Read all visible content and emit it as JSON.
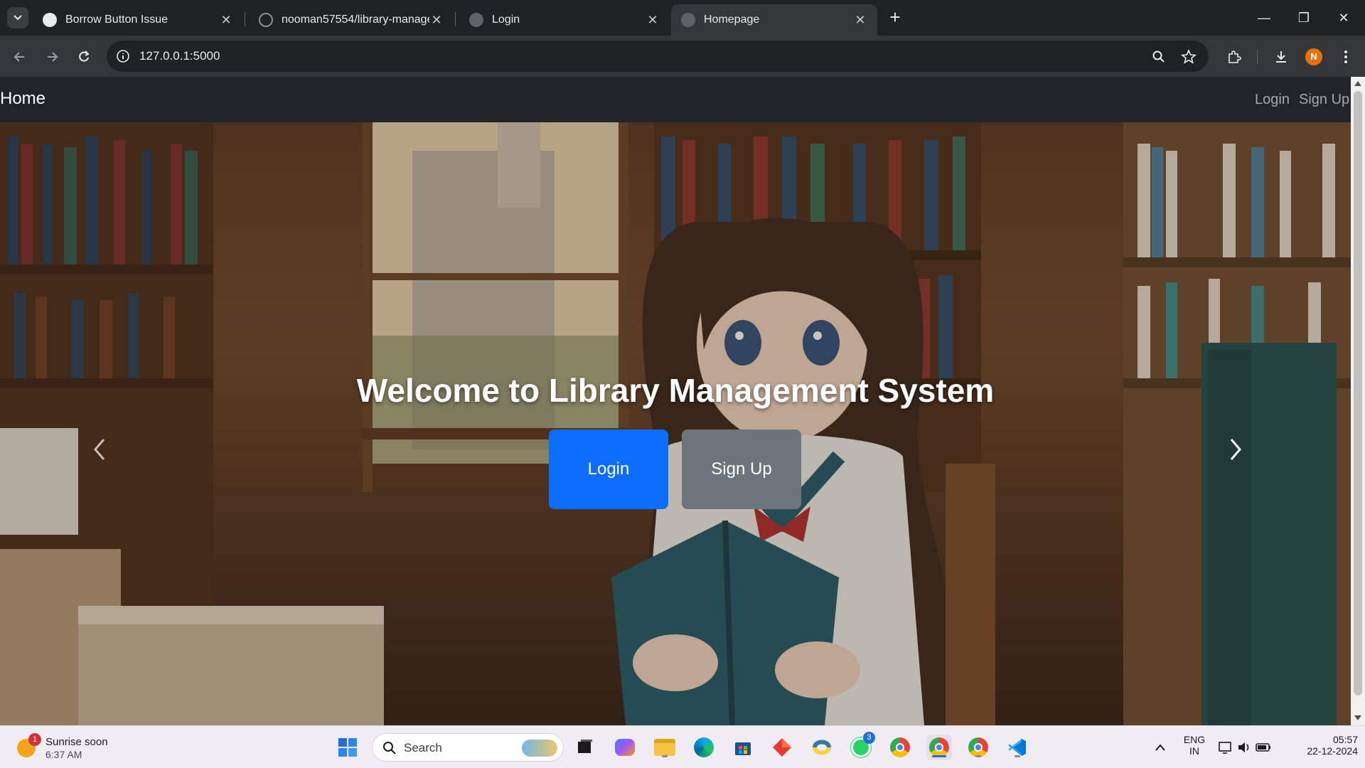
{
  "browser": {
    "tabs": [
      {
        "title": "Borrow Button Issue",
        "favicon": "chatgpt-icon",
        "active": false
      },
      {
        "title": "nooman57554/library-management",
        "favicon": "github-icon",
        "active": false
      },
      {
        "title": "Login",
        "favicon": "globe-icon",
        "active": false
      },
      {
        "title": "Homepage",
        "favicon": "globe-icon",
        "active": true
      }
    ],
    "address": "127.0.0.1:5000",
    "profile_initial": "N",
    "accent": "#e8710a"
  },
  "site": {
    "brand": "Home",
    "nav_links": [
      "Login",
      "Sign Up"
    ],
    "hero_title": "Welcome to Library Management System",
    "buttons": {
      "login": "Login",
      "signup": "Sign Up"
    },
    "colors": {
      "primary": "#0d6efd",
      "secondary": "#6c757d",
      "navbar": "#212529"
    }
  },
  "taskbar": {
    "weather": {
      "title": "Sunrise soon",
      "time": "6:37 AM",
      "badge": "1"
    },
    "search_placeholder": "Search",
    "whatsapp_badge": "3",
    "language": {
      "line1": "ENG",
      "line2": "IN"
    },
    "clock": {
      "time": "05:57",
      "date": "22-12-2024"
    }
  }
}
